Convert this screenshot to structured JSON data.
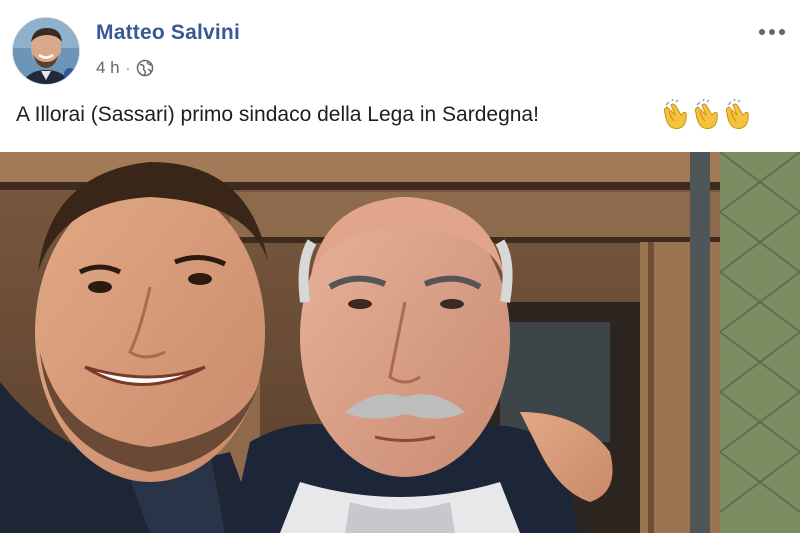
{
  "post": {
    "author": {
      "name": "Matteo Salvini",
      "avatar_icon": "profile-photo"
    },
    "timestamp": "4 h",
    "separator": "·",
    "privacy_icon": "globe-icon",
    "more_icon": "more-options-icon",
    "text": "A Illorai (Sassari) primo sindaco della Lega in Sardegna!",
    "emojis": [
      "clapping-hands",
      "clapping-hands",
      "clapping-hands"
    ],
    "photo_icon": "selfie-photo"
  },
  "colors": {
    "name_link": "#385898",
    "meta_text": "#606770",
    "body_text": "#1c1e21",
    "background": "#ffffff"
  }
}
